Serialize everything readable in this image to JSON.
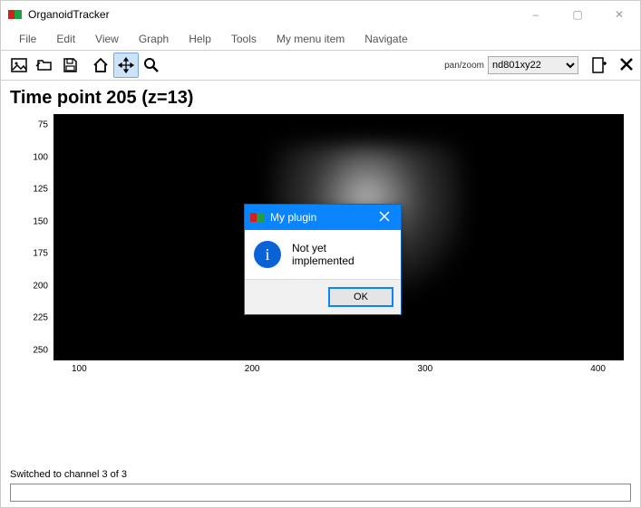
{
  "window": {
    "title": "OrganoidTracker",
    "controls": {
      "minimize": "–",
      "maximize": "▢",
      "close": "✕"
    }
  },
  "menu": {
    "items": [
      "File",
      "Edit",
      "View",
      "Graph",
      "Help",
      "Tools",
      "My menu item",
      "Navigate"
    ]
  },
  "toolbar": {
    "mode_label": "pan/zoom",
    "select_value": "nd801xy22"
  },
  "heading": "Time point 205    (z=13)",
  "plot": {
    "y_ticks": [
      "75",
      "100",
      "125",
      "150",
      "175",
      "200",
      "225",
      "250"
    ],
    "x_ticks": [
      "100",
      "200",
      "300",
      "400"
    ]
  },
  "status": {
    "message": "Switched to channel 3 of 3"
  },
  "dialog": {
    "title": "My plugin",
    "message": "Not yet implemented",
    "ok_label": "OK"
  }
}
